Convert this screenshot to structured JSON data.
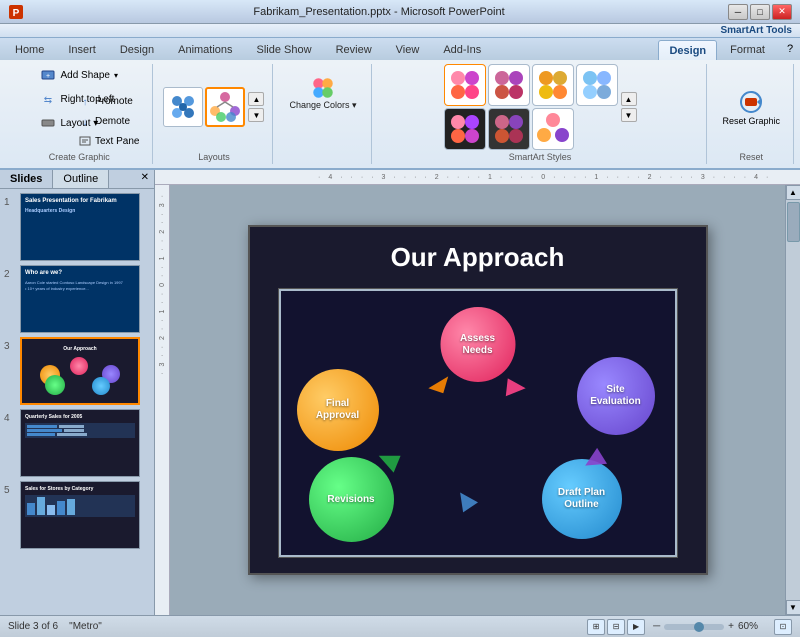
{
  "window": {
    "title": "Fabrikam_Presentation.pptx - Microsoft PowerPoint",
    "smartart_tools": "SmartArt Tools"
  },
  "tabs": {
    "main": [
      "Home",
      "Insert",
      "Design",
      "Animations",
      "Slide Show",
      "Review",
      "View",
      "Add-Ins"
    ],
    "smartart": [
      "Design",
      "Format"
    ]
  },
  "ribbon": {
    "create_graphic": {
      "label": "Create Graphic",
      "add_shape": "Add Shape",
      "right_to_left": "Right to Left",
      "layout": "Layout ▾",
      "promote": "Promote",
      "demote": "Demote",
      "text_pane": "Text Pane"
    },
    "layouts": {
      "label": "Layouts"
    },
    "change_colors": "Change Colors ▾",
    "smartart_styles": {
      "label": "SmartArt Styles"
    },
    "reset": {
      "label": "Reset",
      "reset_graphic": "Reset Graphic"
    }
  },
  "panel": {
    "tabs": [
      "Slides",
      "Outline"
    ],
    "slides": [
      {
        "num": "1",
        "title": "Sales Presentation for Fabrikam Headquarters Design",
        "bg": "#003366"
      },
      {
        "num": "2",
        "title": "Who are we?",
        "bg": "#003366"
      },
      {
        "num": "3",
        "title": "Our Approach",
        "bg": "#1a1a2e",
        "selected": true
      },
      {
        "num": "4",
        "title": "Quarterly Sales for 2005",
        "bg": "#1a1a2e"
      },
      {
        "num": "5",
        "title": "Sales for Stores by Category",
        "bg": "#1a1a2e"
      }
    ]
  },
  "slide": {
    "title": "Our Approach",
    "circles": [
      {
        "id": "assess-needs",
        "label": "Assess\nNeeds",
        "color_start": "#ff88aa",
        "color_end": "#e0205a"
      },
      {
        "id": "site-evaluation",
        "label": "Site\nEvaluation",
        "color_start": "#9988ff",
        "color_end": "#6644cc"
      },
      {
        "id": "draft-plan",
        "label": "Draft Plan\nOutline",
        "color_start": "#66ccff",
        "color_end": "#2288cc"
      },
      {
        "id": "revisions",
        "label": "Revisions",
        "color_start": "#66ff88",
        "color_end": "#22aa44"
      },
      {
        "id": "final-approval",
        "label": "Final\nApproval",
        "color_start": "#ffcc66",
        "color_end": "#ee8800"
      }
    ]
  },
  "status": {
    "slide_info": "Slide 3 of 6",
    "theme": "\"Metro\"",
    "zoom": "60%"
  },
  "icons": {
    "minimize": "─",
    "maximize": "□",
    "close": "✕",
    "scroll_up": "▲",
    "scroll_down": "▼",
    "chevron_up": "▲",
    "chevron_down": "▼",
    "arrow_right": "►",
    "arrow_left": "◄"
  }
}
